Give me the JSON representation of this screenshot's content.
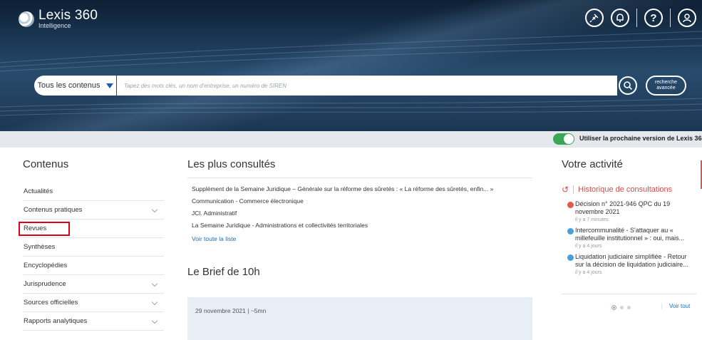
{
  "header": {
    "logo_name": "Lexis 360",
    "logo_sub": "Intelligence",
    "icons": [
      "pin-icon",
      "bell-icon",
      "help-icon",
      "user-icon"
    ]
  },
  "search": {
    "scope_label": "Tous les contenus",
    "placeholder": "Tapez des mots clés, un nom d'entreprise, un numéro de SIREN",
    "advanced_line1": "recherche",
    "advanced_line2": "avancée"
  },
  "version_bar": {
    "label": "Utiliser la prochaine version de Lexis 360",
    "sup": "®",
    "toggle_on": true,
    "toggle_color": "#3aa656"
  },
  "contenus": {
    "title": "Contenus",
    "items": [
      {
        "label": "Actualités",
        "chevron": false
      },
      {
        "label": "Contenus pratiques",
        "chevron": true
      },
      {
        "label": "Revues",
        "chevron": false,
        "highlighted": true
      },
      {
        "label": "Synthèses",
        "chevron": false
      },
      {
        "label": "Encyclopédies",
        "chevron": false
      },
      {
        "label": "Jurisprudence",
        "chevron": true
      },
      {
        "label": "Sources officielles",
        "chevron": true
      },
      {
        "label": "Rapports analytiques",
        "chevron": true
      }
    ]
  },
  "plus_consultes": {
    "title": "Les plus consultés",
    "items": [
      "Supplément de la Semaine Juridique – Générale sur la réforme des sûretés : « La réforme des sûretés, enfin... »",
      "Communication - Commerce électronique",
      "JCl. Administratif",
      "La Semaine Juridique - Administrations et collectivités territoriales"
    ],
    "see_all": "Voir toute la liste"
  },
  "brief": {
    "title": "Le Brief de 10h",
    "date": "29 novembre 2021 | ~5mn"
  },
  "activite": {
    "title": "Votre activité",
    "history_label": "Historique de consultations",
    "items": [
      {
        "title": "Décision n° 2021-946 QPC du 19 novembre 2021",
        "time": "il y a 7 minutes",
        "color": "#e0584f"
      },
      {
        "title": "Intercommunalité - S'attaquer au « millefeuille institutionnel » : oui, mais...",
        "time": "il y a 4 jours",
        "color": "#4a9fd6"
      },
      {
        "title": "Liquidation judiciaire simplifiée - Retour sur la décision de liquidation judiciaire...",
        "time": "il y a 4 jours",
        "color": "#4a9fd6"
      }
    ],
    "voir_tout": "Voir tout"
  },
  "colors": {
    "header_bg": "#1b3550",
    "link": "#1a6fb3",
    "highlight": "#e0001b",
    "history": "#d94a4a"
  }
}
